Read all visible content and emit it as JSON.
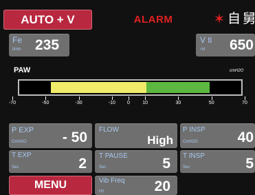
{
  "header": {
    "mode_label": "AUTO + V",
    "alarm_label": "ALARM",
    "alarm_icon": "alarm-star-icon",
    "glyph_1": "自",
    "glyph_2": "舅"
  },
  "top_params": {
    "fe": {
      "label": "Fe",
      "unit": "l/min",
      "value": "235"
    },
    "vti": {
      "label": "V ti",
      "unit": "ml",
      "value": "650"
    }
  },
  "paw_bar": {
    "label": "PAW",
    "unit": "cmH2O",
    "scale_min": -70,
    "scale_max": 70,
    "ticks": [
      "-70",
      "-50",
      "-30",
      "-10",
      "0",
      "10",
      "30",
      "50",
      "70"
    ],
    "yellow_range": [
      -50,
      10
    ],
    "green_range": [
      10,
      50
    ]
  },
  "params": {
    "p_exp": {
      "label": "P EXP",
      "unit": "CmH2O",
      "value": "- 50"
    },
    "flow": {
      "label": "FLOW",
      "unit": "",
      "value": "High"
    },
    "p_insp": {
      "label": "P INSP",
      "unit": "CmH2O",
      "value": "40"
    },
    "t_exp": {
      "label": "T EXP",
      "unit": "Sec",
      "value": "2"
    },
    "t_pause": {
      "label": "T PAUSE",
      "unit": "Sec",
      "value": "5"
    },
    "t_insp": {
      "label": "T INSP",
      "unit": "Sec",
      "value": "5"
    },
    "vib_freq": {
      "label": "Vib Freq",
      "unit": "Hz",
      "value": "20"
    }
  },
  "menu_label": "MENU",
  "colors": {
    "accent_red": "#b8283f",
    "tile_gray": "#6f6f6f",
    "label_blue": "#a8c8f0",
    "yellow": "#f0ec6a",
    "green": "#5cb840",
    "alarm": "#e02020"
  }
}
